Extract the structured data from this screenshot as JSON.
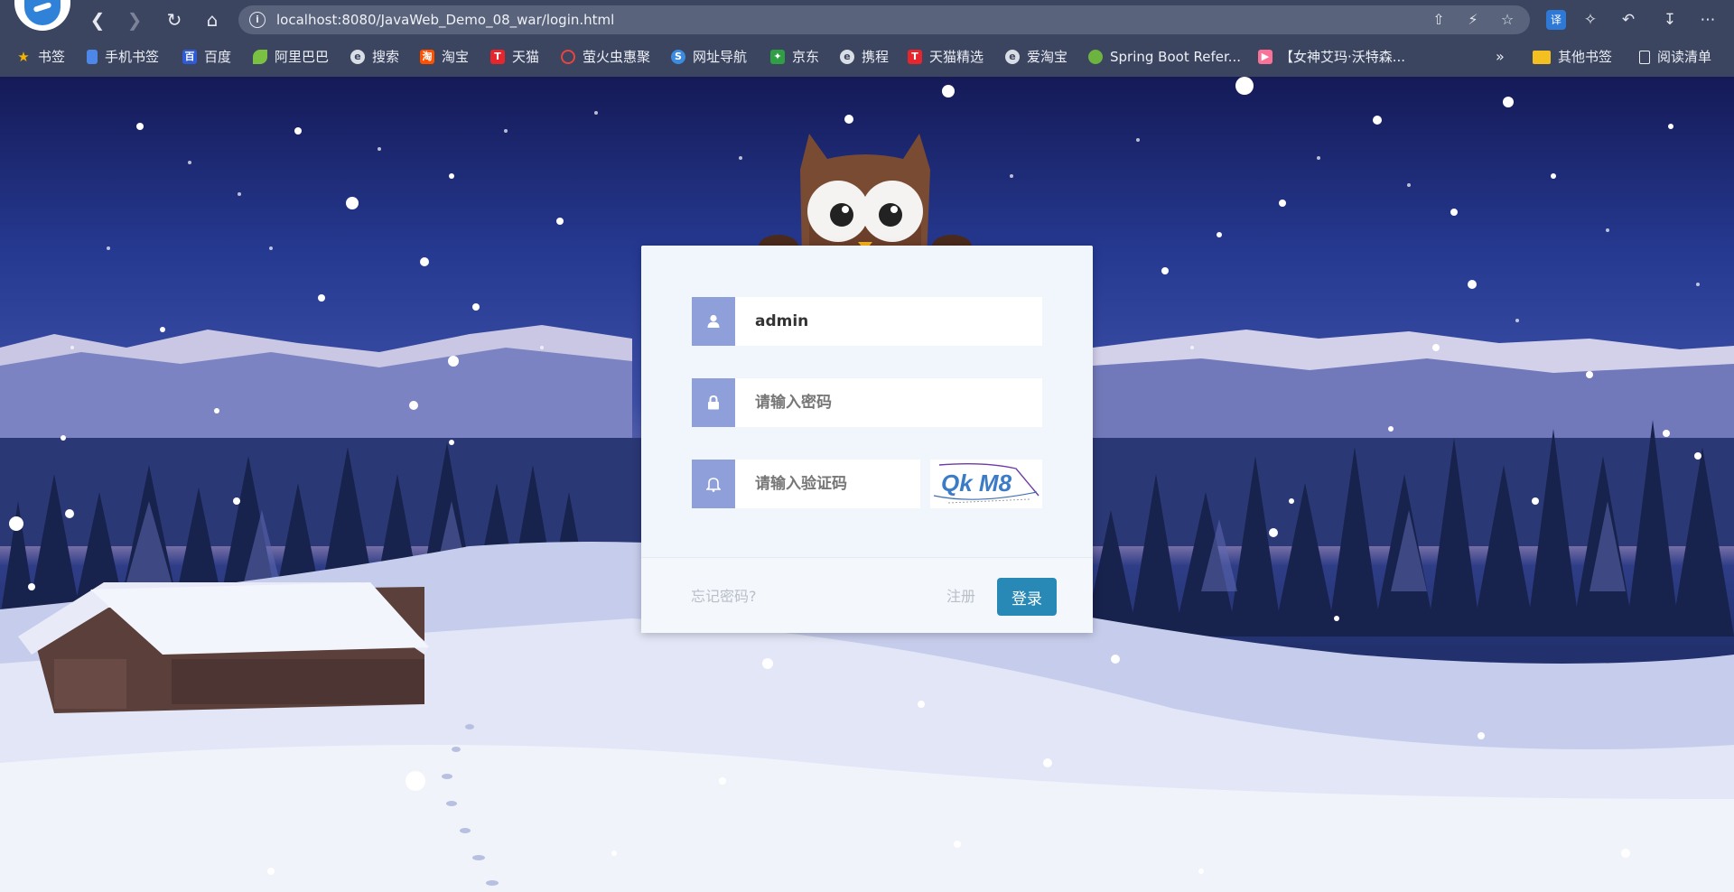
{
  "browser": {
    "url": "localhost:8080/JavaWeb_Demo_08_war/login.html",
    "bookmarks": [
      {
        "label": "书签",
        "color": "#f4b400"
      },
      {
        "label": "手机书签",
        "color": "#4d88e8"
      },
      {
        "label": "百度",
        "color": "#2f5cd6"
      },
      {
        "label": "阿里巴巴",
        "color": "#7ac143"
      },
      {
        "label": "搜索",
        "color": "#d9dde6"
      },
      {
        "label": "淘宝",
        "color": "#ff5000"
      },
      {
        "label": "天猫",
        "color": "#e6262d"
      },
      {
        "label": "萤火虫惠聚",
        "color": "#e8453c"
      },
      {
        "label": "网址导航",
        "color": "#3d8be0"
      },
      {
        "label": "京东",
        "color": "#2f9e44"
      },
      {
        "label": "携程",
        "color": "#d9dde6"
      },
      {
        "label": "天猫精选",
        "color": "#e6262d"
      },
      {
        "label": "爱淘宝",
        "color": "#d9dde6"
      },
      {
        "label": "Spring Boot Refer...",
        "color": "#6db33f"
      },
      {
        "label": "【女神艾玛·沃特森...",
        "color": "#fb7299"
      }
    ],
    "more_bookmarks": "»",
    "other_bookmarks": "其他书签",
    "reading_list": "阅读清单",
    "translate_label": "译"
  },
  "login": {
    "username_value": "admin",
    "password_placeholder": "请输入密码",
    "captcha_placeholder": "请输入验证码",
    "captcha_text": "Qk M8",
    "forgot_label": "忘记密码?",
    "register_label": "注册",
    "login_label": "登录"
  },
  "colors": {
    "accent": "#2889b7",
    "icon_box": "#8e9fd9"
  }
}
